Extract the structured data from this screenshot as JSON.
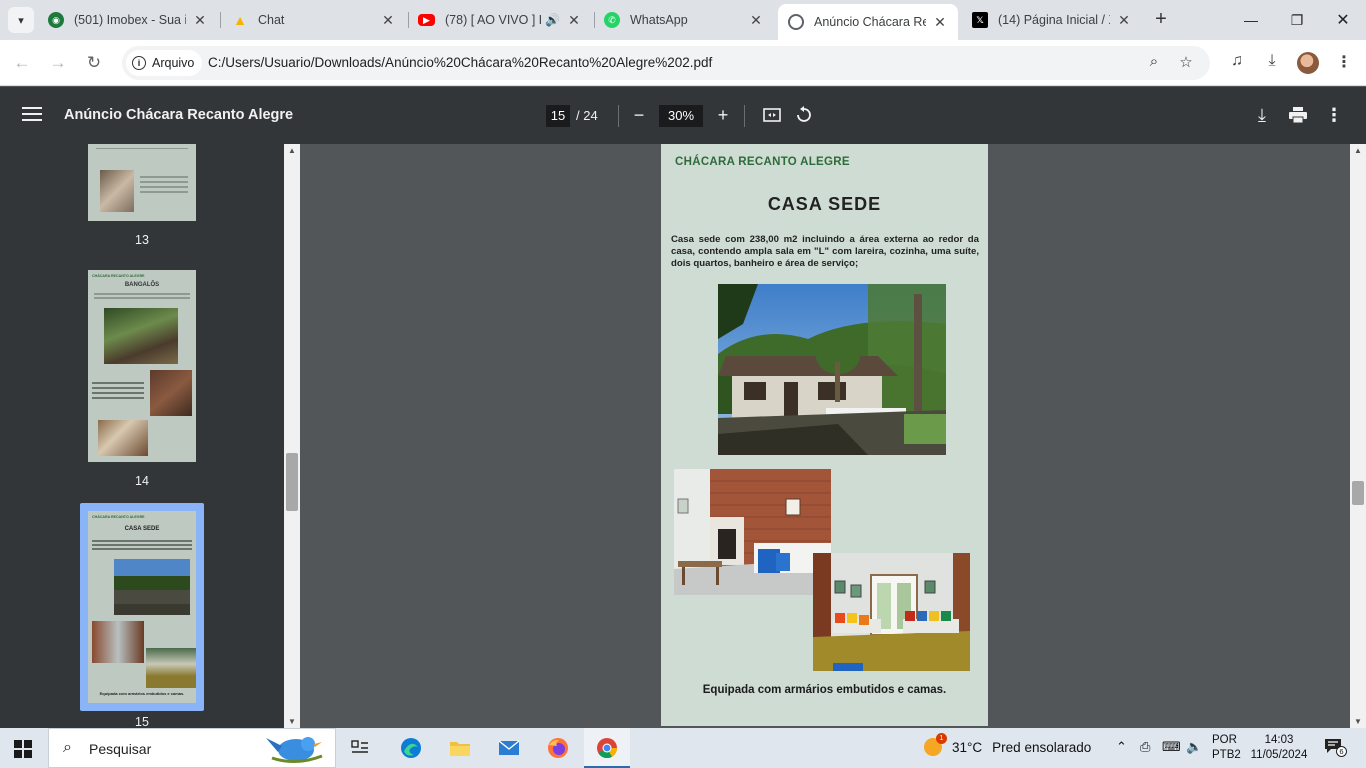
{
  "tabs": [
    {
      "title": "(501) Imobex - Sua im",
      "icon": "imobex-icon"
    },
    {
      "title": "Chat",
      "icon": "chat-icon"
    },
    {
      "title": "(78) [ AO VIVO ] L",
      "icon": "youtube-icon"
    },
    {
      "title": "WhatsApp",
      "icon": "whatsapp-icon"
    },
    {
      "title": "Anúncio Chácara Rec",
      "icon": "globe-icon",
      "active": true
    },
    {
      "title": "(14) Página Inicial / X",
      "icon": "x-icon"
    }
  ],
  "toolbar": {
    "chip_label": "Arquivo",
    "url": "C:/Users/Usuario/Downloads/Anúncio%20Chácara%20Recanto%20Alegre%202.pdf"
  },
  "pdf": {
    "title": "Anúncio Chácara Recanto Alegre",
    "current_page": "15",
    "total_pages": "/ 24",
    "zoom": "30%"
  },
  "thumbnails": [
    {
      "label": "13"
    },
    {
      "label": "14",
      "header": "CHÁCARA RECANTO ALEGRE",
      "title": "BANGALÔS"
    },
    {
      "label": "15",
      "header": "CHÁCARA RECANTO ALEGRE",
      "title": "CASA SEDE",
      "footer": "Equipada com armários embutidos  e camas."
    }
  ],
  "page": {
    "header": "CHÁCARA RECANTO ALEGRE",
    "title": "CASA  SEDE",
    "description": "Casa sede com 238,00 m2 incluindo a área externa ao redor da casa, contendo ampla sala em \"L\" com lareira, cozinha, uma suíte, dois quartos, banheiro e área de serviço;",
    "footer": "Equipada com armários embutidos  e camas."
  },
  "taskbar": {
    "search_placeholder": "Pesquisar",
    "weather_temp": "31°C",
    "weather_desc": "Pred ensolarado",
    "weather_badge": "1",
    "lang_line1": "POR",
    "lang_line2": "PTB2",
    "time": "14:03",
    "date": "11/05/2024",
    "notification_count": "6"
  },
  "colors": {
    "pdf_bar": "#323639",
    "viewer_bg": "#525659",
    "page_bg": "#cfdcd3",
    "header_green": "#2e6b3a",
    "selection": "#8ab4f8"
  }
}
